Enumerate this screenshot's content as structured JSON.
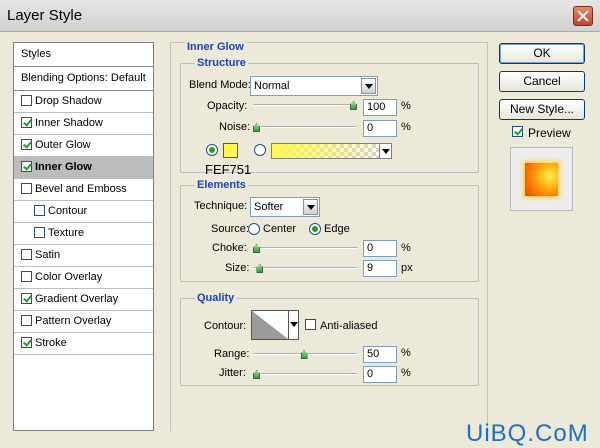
{
  "window": {
    "title": "Layer Style"
  },
  "styles_list": {
    "header": "Styles",
    "blending": "Blending Options: Default",
    "items": [
      {
        "label": "Drop Shadow",
        "checked": false
      },
      {
        "label": "Inner Shadow",
        "checked": true
      },
      {
        "label": "Outer Glow",
        "checked": true
      },
      {
        "label": "Inner Glow",
        "checked": true
      },
      {
        "label": "Bevel and Emboss",
        "checked": false
      },
      {
        "label": "Contour",
        "checked": false
      },
      {
        "label": "Texture",
        "checked": false
      },
      {
        "label": "Satin",
        "checked": false
      },
      {
        "label": "Color Overlay",
        "checked": false
      },
      {
        "label": "Gradient Overlay",
        "checked": true
      },
      {
        "label": "Pattern Overlay",
        "checked": false
      },
      {
        "label": "Stroke",
        "checked": true
      }
    ]
  },
  "panel": {
    "title": "Inner Glow",
    "structure": {
      "title": "Structure",
      "blend_mode_label": "Blend Mode:",
      "blend_mode": "Normal",
      "opacity_label": "Opacity:",
      "opacity": "100",
      "opacity_level": 1.0,
      "noise_label": "Noise:",
      "noise": "0",
      "noise_level": 0.0,
      "percent": "%",
      "color_hex": "FEF751",
      "color": "#fef751",
      "color_mode": "solid"
    },
    "elements": {
      "title": "Elements",
      "technique_label": "Technique:",
      "technique": "Softer",
      "source_label": "Source:",
      "source_center": "Center",
      "source_edge": "Edge",
      "source": "edge",
      "choke_label": "Choke:",
      "choke": "0",
      "choke_level": 0.0,
      "size_label": "Size:",
      "size": "9",
      "size_unit": "px",
      "size_level": 0.036,
      "percent": "%"
    },
    "quality": {
      "title": "Quality",
      "contour_label": "Contour:",
      "anti_aliased_label": "Anti-aliased",
      "anti_aliased": false,
      "range_label": "Range:",
      "range": "50",
      "range_level": 0.49,
      "jitter_label": "Jitter:",
      "jitter": "0",
      "jitter_level": 0.0,
      "percent": "%"
    }
  },
  "buttons": {
    "ok": "OK",
    "cancel": "Cancel",
    "new_style": "New Style...",
    "preview_label": "Preview",
    "preview_checked": true
  },
  "watermark": "UiBQ.CoM"
}
